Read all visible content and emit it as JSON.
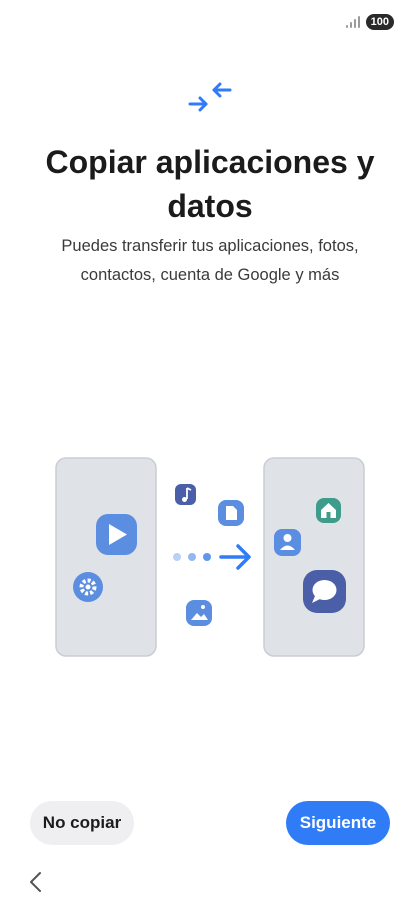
{
  "status_bar": {
    "battery_level": "100",
    "signal_icon": "signal-bars-icon"
  },
  "header": {
    "icon": "transfer-arrows-icon",
    "title": "Copiar aplicaciones y datos",
    "subtitle": "Puedes transferir tus aplicaciones, fotos, contactos, cuenta de Google y más"
  },
  "illustration": {
    "icons": [
      "video-play-icon",
      "settings-icon",
      "music-note-icon",
      "document-icon",
      "image-icon",
      "home-icon",
      "contact-icon",
      "message-icon",
      "arrow-right-icon"
    ]
  },
  "actions": {
    "skip_label": "No copiar",
    "next_label": "Siguiente"
  },
  "colors": {
    "accent": "#2f7cf6",
    "phone_fill": "#dfe3e7",
    "icon_blue": "#5b8de0",
    "icon_indigo": "#4b5ea8",
    "icon_teal": "#3d9c8a"
  },
  "navigation": {
    "back_icon": "chevron-left-icon"
  }
}
